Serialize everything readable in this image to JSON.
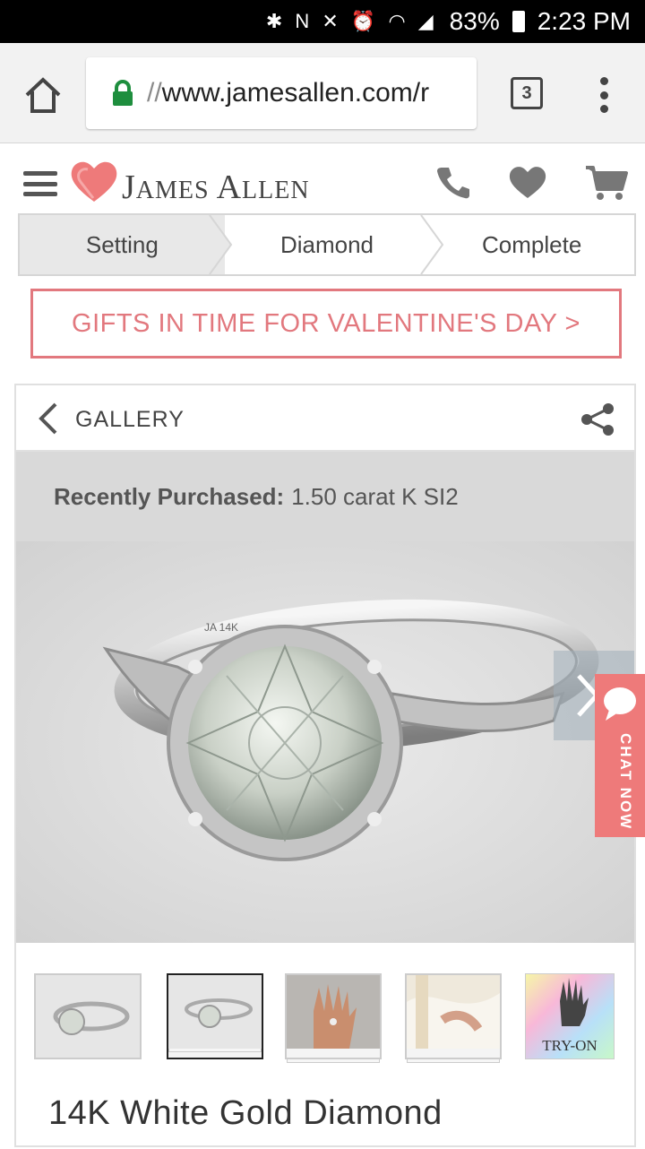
{
  "status_bar": {
    "battery": "83%",
    "time": "2:23 PM"
  },
  "browser": {
    "url_prefix": "//",
    "url_text": "www.jamesallen.com/r",
    "tab_count": "3"
  },
  "site": {
    "logo_first_initial": "J",
    "logo_first_rest": "AMES",
    "logo_last_initial": "A",
    "logo_last_rest": "LLEN"
  },
  "steps": [
    {
      "label": "Setting",
      "active": true
    },
    {
      "label": "Diamond",
      "active": false
    },
    {
      "label": "Complete",
      "active": false
    }
  ],
  "promo": "GIFTS IN TIME FOR VALENTINE'S DAY >",
  "gallery": {
    "label": "GALLERY",
    "recent_label": "Recently Purchased:",
    "recent_value": "1.50 carat K SI2",
    "engraving": "JA 14K",
    "tryon_label": "TRY-ON"
  },
  "chat": {
    "label": "CHAT NOW"
  },
  "product": {
    "title": "14K White Gold Diamond"
  },
  "colors": {
    "accent": "#e2787e",
    "chat": "#ee7a7a",
    "lock_green": "#1e8e3e"
  }
}
